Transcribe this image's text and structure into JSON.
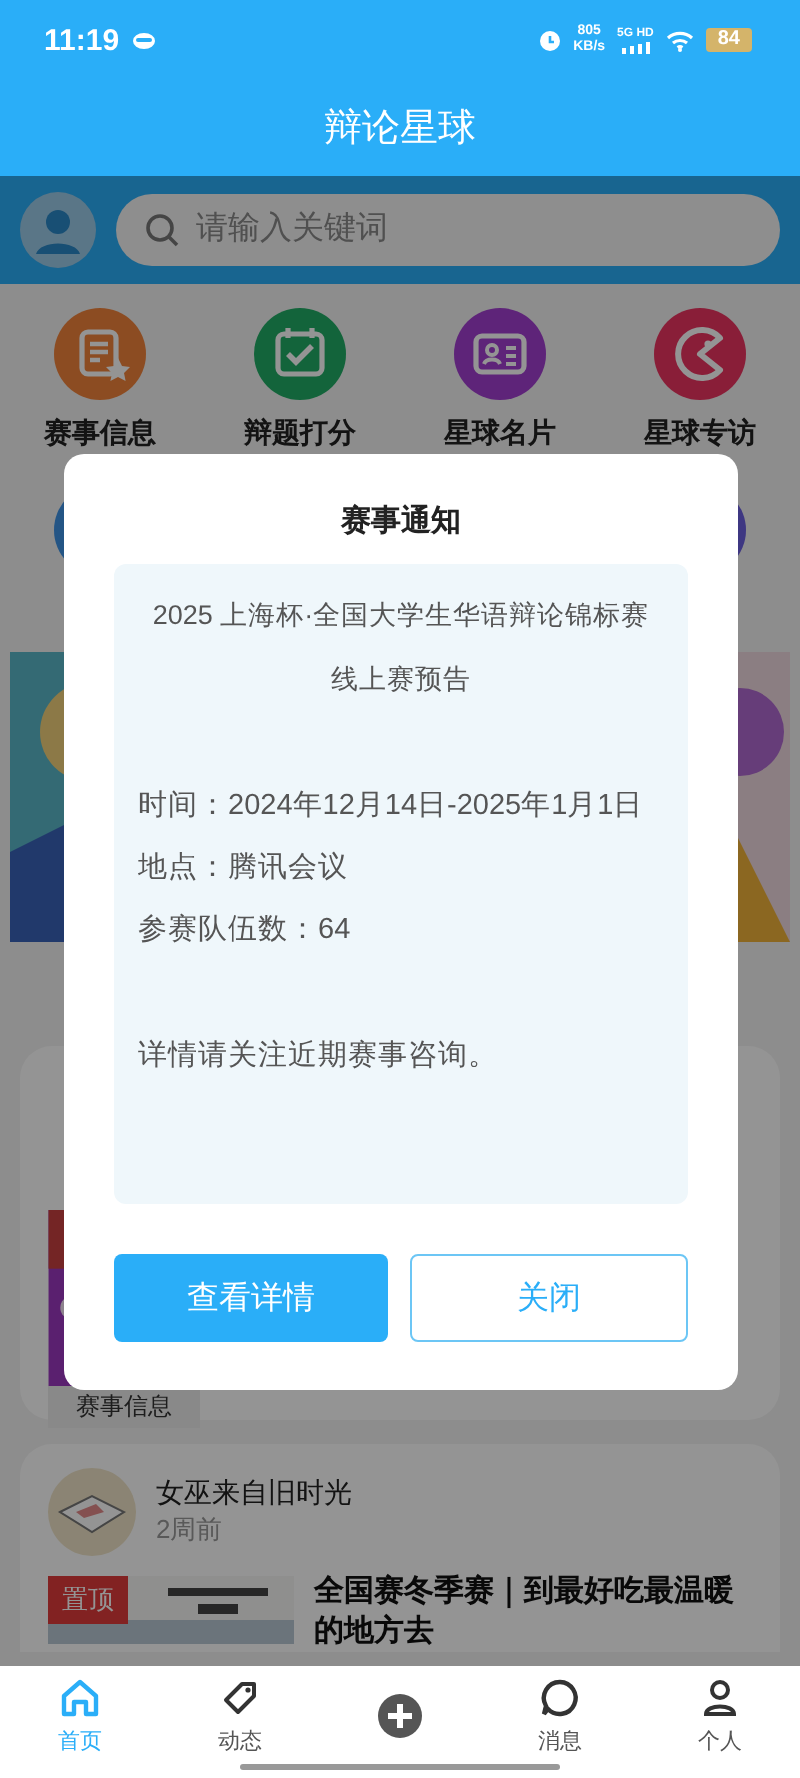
{
  "status_bar": {
    "time": "11:19",
    "net_speed": "805",
    "net_unit": "KB/s",
    "network": "5G HD",
    "battery": "84"
  },
  "header": {
    "title": "辩论星球"
  },
  "search": {
    "placeholder": "请输入关键词"
  },
  "categories": [
    {
      "label": "赛事信息",
      "kind": "document"
    },
    {
      "label": "辩题打分",
      "kind": "calendar"
    },
    {
      "label": "星球名片",
      "kind": "card"
    },
    {
      "label": "星球专访",
      "kind": "pacman"
    }
  ],
  "categories_row2": [
    {
      "kind": "blue"
    },
    {
      "kind": "indigo"
    }
  ],
  "event_card": {
    "tag": "赛事信息"
  },
  "post": {
    "author": "女巫来自旧时光",
    "time": "2周前",
    "badge": "置顶",
    "title": "全国赛冬季赛｜到最好吃最温暖的地方去"
  },
  "dialog": {
    "title": "赛事通知",
    "headline": [
      "2025 上海杯·全国大学生华语辩论锦标赛",
      "线上赛预告"
    ],
    "details": [
      "时间：2024年12月14日-2025年1月1日",
      "地点：腾讯会议",
      "参赛队伍数：64"
    ],
    "note": "详情请关注近期赛事咨询。",
    "buttons": [
      {
        "label": "查看详情",
        "kind": "primary"
      },
      {
        "label": "关闭",
        "kind": "outline"
      }
    ]
  },
  "nav": [
    {
      "label": "首页",
      "kind": "home",
      "selected": true
    },
    {
      "label": "动态",
      "kind": "tag",
      "selected": false
    },
    {
      "kind": "add"
    },
    {
      "label": "消息",
      "kind": "chat",
      "selected": false
    },
    {
      "label": "个人",
      "kind": "person",
      "selected": false
    }
  ]
}
